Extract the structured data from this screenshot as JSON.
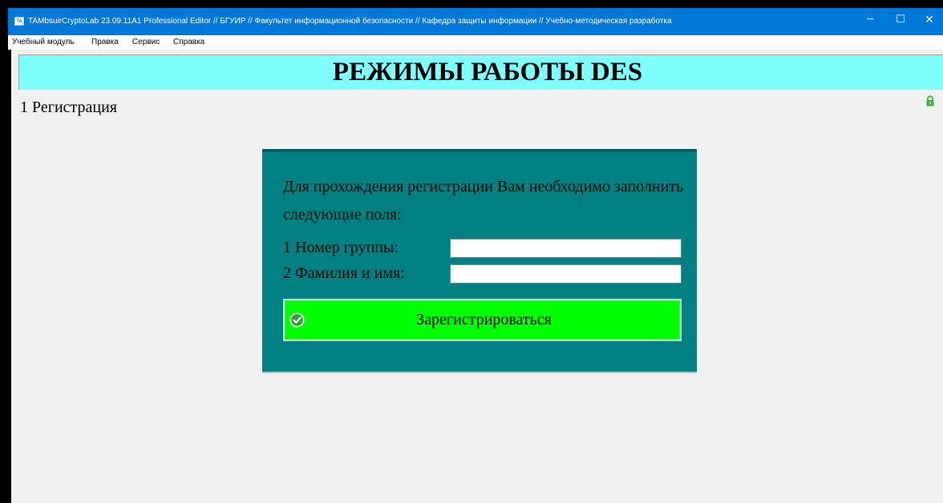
{
  "window": {
    "title": "TAMbsuirCryptoLab 23.09.11A1 Professional Editor // БГУИР // Факультет информационной безопасности // Кафедра защиты информации // Учебно-методическая разработка",
    "icon_text": "TA",
    "controls": {
      "minimize": "─",
      "maximize": "☐",
      "close": "✕"
    }
  },
  "menu": {
    "items": [
      {
        "label": "Учебный модуль"
      },
      {
        "label": "Правка"
      },
      {
        "label": "Сервис"
      },
      {
        "label": "Справка"
      }
    ]
  },
  "banner": {
    "title": "РЕЖИМЫ РАБОТЫ DES"
  },
  "section": {
    "title": "1 Регистрация"
  },
  "registration": {
    "instructions": "Для прохождения регистрации Вам необходимо заполнить следующие поля:",
    "group_label": "1 Номер группы:",
    "group_value": "",
    "name_label": "2 Фамилия и имя:",
    "name_value": "",
    "submit_label": "Зарегистрироваться"
  },
  "icons": {
    "app": "app-icon",
    "lock": "lock-icon",
    "submit": "check-circle-icon"
  },
  "colors": {
    "titlebar": "#0078d7",
    "banner": "#80ffff",
    "panel": "#008080",
    "submit_button": "#00ff00",
    "lock": "#3cb043"
  }
}
